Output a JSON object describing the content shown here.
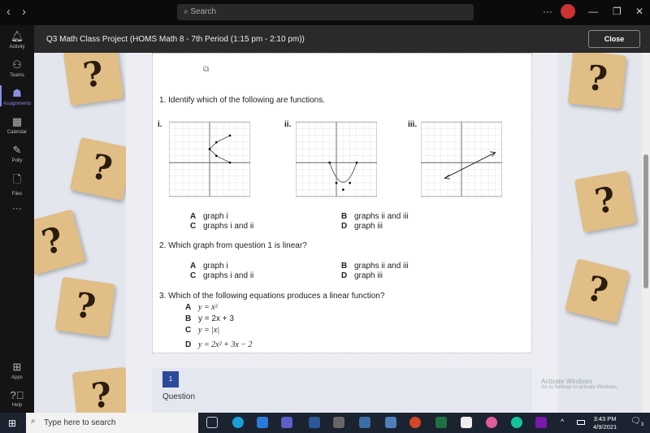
{
  "topbar": {
    "search_placeholder": "Search",
    "more": "···"
  },
  "rail": {
    "items": [
      {
        "label": "Activity",
        "icon": "bell-icon"
      },
      {
        "label": "Teams",
        "icon": "teams-icon"
      },
      {
        "label": "Assignments",
        "icon": "assignments-icon"
      },
      {
        "label": "Calendar",
        "icon": "calendar-icon"
      },
      {
        "label": "Polly",
        "icon": "polly-icon"
      },
      {
        "label": "Files",
        "icon": "file-icon"
      },
      {
        "label": "···",
        "icon": "more-icon"
      },
      {
        "label": "Apps",
        "icon": "apps-icon"
      },
      {
        "label": "Help",
        "icon": "help-icon"
      }
    ]
  },
  "titlebar": {
    "title": "Q3 Math Class Project (HOMS Math 8 - 7th Period (1:15 pm - 2:10 pm))",
    "close": "Close"
  },
  "worksheet": {
    "q1": {
      "text": "1.  Identify which of the following are functions.",
      "graph_labels": [
        "i.",
        "ii.",
        "iii."
      ],
      "options": [
        {
          "letter": "A",
          "text": "graph i"
        },
        {
          "letter": "B",
          "text": "graphs ii and iii"
        },
        {
          "letter": "C",
          "text": "graphs i and ii"
        },
        {
          "letter": "D",
          "text": "graph iii"
        }
      ]
    },
    "q2": {
      "text": "2.  Which graph from question 1 is linear?",
      "options": [
        {
          "letter": "A",
          "text": "graph i"
        },
        {
          "letter": "B",
          "text": "graphs ii and iii"
        },
        {
          "letter": "C",
          "text": "graphs i and ii"
        },
        {
          "letter": "D",
          "text": "graph iii"
        }
      ]
    },
    "q3": {
      "text": "3.  Which of the following equations produces a linear function?",
      "options": [
        {
          "letter": "A",
          "text": "y = x²"
        },
        {
          "letter": "B",
          "text": "y = 2x + 3"
        },
        {
          "letter": "C",
          "text": "y = |x|"
        },
        {
          "letter": "D",
          "text": "y = 2x² + 3x − 2"
        }
      ]
    }
  },
  "question_nav": {
    "number": "1",
    "label": "Question"
  },
  "watermark": {
    "line1": "Activate Windows",
    "line2": "Go to Settings to activate Windows."
  },
  "taskbar": {
    "search_placeholder": "Type here to search",
    "time": "3:43 PM",
    "date": "4/9/2021",
    "notifications": "3"
  }
}
